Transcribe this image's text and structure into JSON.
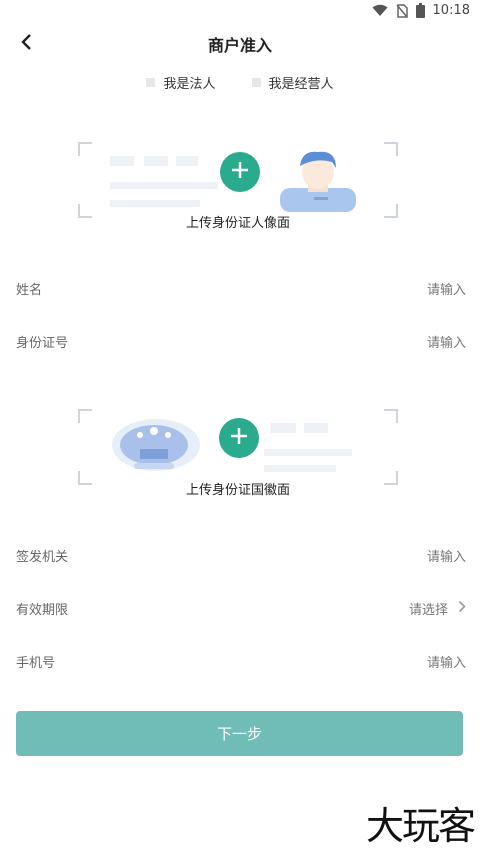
{
  "status_bar": {
    "time": "10:18",
    "icons": [
      "wifi-icon",
      "no-sim-icon",
      "battery-icon"
    ]
  },
  "header": {
    "title": "商户准入",
    "back_icon": "chevron-left-icon"
  },
  "role_options": [
    {
      "label": "我是法人",
      "checked": false
    },
    {
      "label": "我是经营人",
      "checked": false
    }
  ],
  "upload_portrait": {
    "label": "上传身份证人像面",
    "icon": "plus-icon"
  },
  "fields_top": [
    {
      "label": "姓名",
      "placeholder": "请输入"
    },
    {
      "label": "身份证号",
      "placeholder": "请输入"
    }
  ],
  "upload_emblem": {
    "label": "上传身份证国徽面",
    "icon": "plus-icon"
  },
  "fields_bottom": [
    {
      "label": "签发机关",
      "placeholder": "请输入"
    },
    {
      "label": "有效期限",
      "placeholder": "请选择"
    },
    {
      "label": "手机号",
      "placeholder": "请输入"
    }
  ],
  "next_button": {
    "label": "下一步"
  },
  "watermark": "大玩客",
  "colors": {
    "accent": "#2bab8e",
    "button": "#6fbdb6",
    "placeholder_bar": "#eef1f6"
  }
}
